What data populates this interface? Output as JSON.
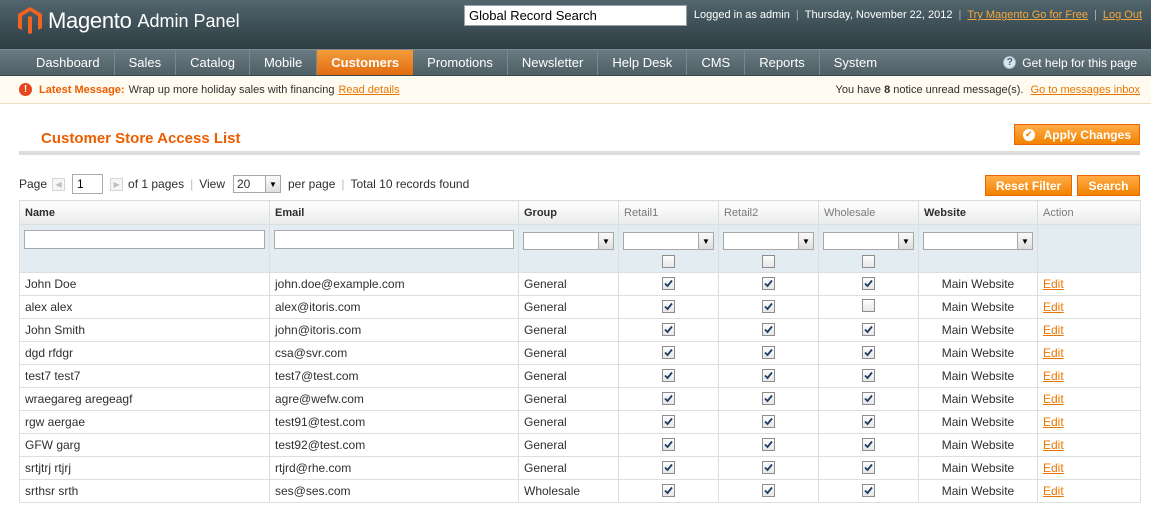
{
  "header": {
    "brand": "Magento",
    "sub": "Admin Panel",
    "search_value": "Global Record Search",
    "logged_in": "Logged in as admin",
    "date": "Thursday, November 22, 2012",
    "try_link": "Try Magento Go for Free",
    "logout": "Log Out"
  },
  "nav": {
    "items": [
      "Dashboard",
      "Sales",
      "Catalog",
      "Mobile",
      "Customers",
      "Promotions",
      "Newsletter",
      "Help Desk",
      "CMS",
      "Reports",
      "System"
    ],
    "active": "Customers",
    "help": "Get help for this page"
  },
  "message": {
    "label": "Latest Message:",
    "text": "Wrap up more holiday sales with financing",
    "link": "Read details",
    "notice_prefix": "You have",
    "notice_count": "8",
    "notice_suffix": "notice unread message(s).",
    "inbox_link": "Go to messages inbox"
  },
  "page": {
    "title": "Customer Store Access List",
    "apply_button": "Apply Changes"
  },
  "pager": {
    "page_label": "Page",
    "page_value": "1",
    "of_pages": "of 1 pages",
    "view_label": "View",
    "view_value": "20",
    "per_page": "per page",
    "total": "Total 10 records found",
    "reset_button": "Reset Filter",
    "search_button": "Search"
  },
  "grid": {
    "columns": [
      "Name",
      "Email",
      "Group",
      "Retail1",
      "Retail2",
      "Wholesale",
      "Website",
      "Action"
    ],
    "rows": [
      {
        "name": "John Doe",
        "email": "john.doe@example.com",
        "group": "General",
        "retail1": true,
        "retail2": true,
        "wholesale": true,
        "website": "Main Website",
        "action": "Edit"
      },
      {
        "name": "alex alex",
        "email": "alex@itoris.com",
        "group": "General",
        "retail1": true,
        "retail2": true,
        "wholesale": false,
        "website": "Main Website",
        "action": "Edit"
      },
      {
        "name": "John Smith",
        "email": "john@itoris.com",
        "group": "General",
        "retail1": true,
        "retail2": true,
        "wholesale": true,
        "website": "Main Website",
        "action": "Edit"
      },
      {
        "name": "dgd rfdgr",
        "email": "csa@svr.com",
        "group": "General",
        "retail1": true,
        "retail2": true,
        "wholesale": true,
        "website": "Main Website",
        "action": "Edit"
      },
      {
        "name": "test7 test7",
        "email": "test7@test.com",
        "group": "General",
        "retail1": true,
        "retail2": true,
        "wholesale": true,
        "website": "Main Website",
        "action": "Edit"
      },
      {
        "name": "wraegareg aregeagf",
        "email": "agre@wefw.com",
        "group": "General",
        "retail1": true,
        "retail2": true,
        "wholesale": true,
        "website": "Main Website",
        "action": "Edit"
      },
      {
        "name": "rgw aergae",
        "email": "test91@test.com",
        "group": "General",
        "retail1": true,
        "retail2": true,
        "wholesale": true,
        "website": "Main Website",
        "action": "Edit"
      },
      {
        "name": "GFW garg",
        "email": "test92@test.com",
        "group": "General",
        "retail1": true,
        "retail2": true,
        "wholesale": true,
        "website": "Main Website",
        "action": "Edit"
      },
      {
        "name": "srtjtrj rtjrj",
        "email": "rtjrd@rhe.com",
        "group": "General",
        "retail1": true,
        "retail2": true,
        "wholesale": true,
        "website": "Main Website",
        "action": "Edit"
      },
      {
        "name": "srthsr srth",
        "email": "ses@ses.com",
        "group": "Wholesale",
        "retail1": true,
        "retail2": true,
        "wholesale": true,
        "website": "Main Website",
        "action": "Edit"
      }
    ]
  },
  "colors": {
    "accent": "#eb5e00",
    "nav_active": "#e26b10",
    "link": "#ea7601"
  }
}
